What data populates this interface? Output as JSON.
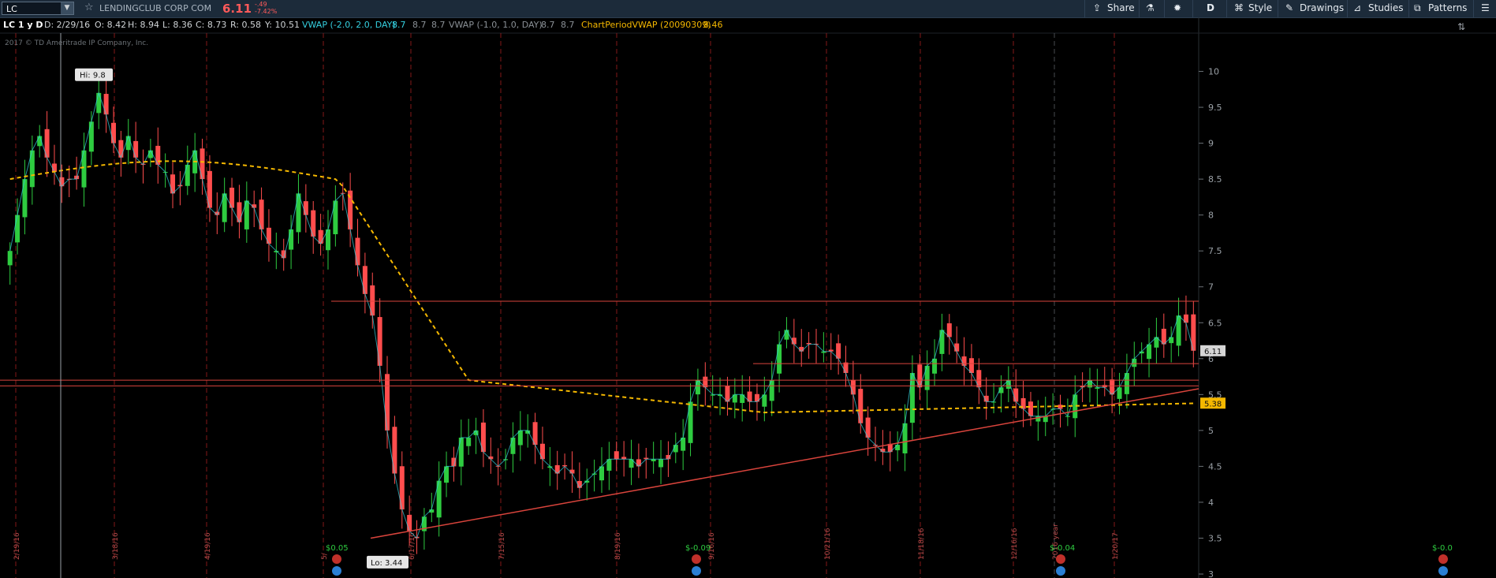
{
  "toolbar": {
    "symbol": "LC",
    "company": "LENDINGCLUB CORP COM",
    "price": "6.11",
    "change": "-.49",
    "change_pct": "-7.42%",
    "share": "Share",
    "timeframe": "D",
    "style": "Style",
    "drawings": "Drawings",
    "studies": "Studies",
    "patterns": "Patterns"
  },
  "infobar": {
    "title": "LC 1 y D",
    "date": "D: 2/29/16",
    "open": "O: 8.42",
    "high": "H: 8.94",
    "low": "L: 8.36",
    "close": "C: 8.73",
    "range": "R: 0.58",
    "y": "Y: 10.51",
    "vwap1_label": "VWAP (-2.0, 2.0, DAY)",
    "vwap1_v1": "8.7",
    "vwap1_v2": "8.7",
    "vwap1_v3": "8.7",
    "vwap2_label": "VWAP (-1.0, 1.0, DAY)",
    "vwap2_v1": "8.7",
    "vwap2_v2": "8.7",
    "cpvwap_label": "ChartPeriodVWAP (20090309)",
    "cpvwap_value": "8.46"
  },
  "copyright": "2017 © TD Ameritrade IP Company, Inc.",
  "chart_data": {
    "type": "candlestick",
    "symbol": "LC",
    "period": "1 y D",
    "ylim": [
      3,
      10.5
    ],
    "y_ticks": [
      3,
      3.5,
      4,
      4.5,
      5,
      5.5,
      6,
      6.5,
      7,
      7.5,
      8,
      8.5,
      9,
      9.5,
      10
    ],
    "x_labels": [
      "2/19/16",
      "3/18/16",
      "4/19/16",
      "5/",
      "6/17/16",
      "7/15/16",
      "8/19/16",
      "9/16/16",
      "10/21/16",
      "11/18/16",
      "12/16/16",
      "2016 year",
      "1/20/17"
    ],
    "hi_label": "Hi: 9.8",
    "hi_value": 9.8,
    "lo_label": "Lo: 3.44",
    "lo_value": 3.44,
    "last_price": "6.11",
    "vwap_last": "5.38",
    "horizontal_lines": [
      6.8,
      5.93,
      5.7,
      5.62
    ],
    "trendline": {
      "start": 3.5,
      "end": 5.58
    },
    "events": [
      {
        "label": "$0.05",
        "x_label": "5/"
      },
      {
        "label": "$-0.09",
        "x_label": "8/19/16"
      },
      {
        "label": "$-0.04",
        "x_label": "11/18/16"
      },
      {
        "label": "$-0.0",
        "x_label": "1/20/17"
      }
    ],
    "closes": [
      7.5,
      8.0,
      8.5,
      8.9,
      9.1,
      8.8,
      8.6,
      8.4,
      8.5,
      8.5,
      8.9,
      9.3,
      9.7,
      9.4,
      9.0,
      8.8,
      9.1,
      8.8,
      8.7,
      8.9,
      8.7,
      8.6,
      8.3,
      8.4,
      8.7,
      8.9,
      8.5,
      8.1,
      8.0,
      8.3,
      8.1,
      7.9,
      8.2,
      8.1,
      7.8,
      7.6,
      7.5,
      7.4,
      7.8,
      8.3,
      8.0,
      7.7,
      7.6,
      7.8,
      8.2,
      8.3,
      7.8,
      7.3,
      6.9,
      6.6,
      5.9,
      5.0,
      4.4,
      3.9,
      3.6,
      3.5,
      3.8,
      3.9,
      4.3,
      4.5,
      4.5,
      4.9,
      4.9,
      5.0,
      4.7,
      4.6,
      4.5,
      4.6,
      4.9,
      5.0,
      5.0,
      4.8,
      4.6,
      4.5,
      4.4,
      4.5,
      4.4,
      4.2,
      4.3,
      4.4,
      4.5,
      4.6,
      4.6,
      4.6,
      4.6,
      4.5,
      4.6,
      4.6,
      4.6,
      4.6,
      4.8,
      4.9,
      5.4,
      5.7,
      5.6,
      5.5,
      5.5,
      5.4,
      5.5,
      5.5,
      5.4,
      5.4,
      5.5,
      5.7,
      6.2,
      6.4,
      6.2,
      6.1,
      6.2,
      6.2,
      6.1,
      6.1,
      6.0,
      5.8,
      5.5,
      5.1,
      4.9,
      4.8,
      4.7,
      4.7,
      4.8,
      5.1,
      5.8,
      5.6,
      5.9,
      6.0,
      6.4,
      6.3,
      6.1,
      5.9,
      5.8,
      5.6,
      5.4,
      5.4,
      5.6,
      5.7,
      5.4,
      5.3,
      5.2,
      5.2,
      5.2,
      5.3,
      5.3,
      5.2,
      5.5,
      5.6,
      5.7,
      5.6,
      5.6,
      5.5,
      5.6,
      5.8,
      6.0,
      6.1,
      6.2,
      6.3,
      6.2,
      6.3,
      6.6,
      6.5,
      6.11
    ]
  },
  "colors": {
    "up": "#2ecc40",
    "down": "#ff4d4d",
    "vwap": "#f5b800",
    "line": "#d9443c",
    "grid": "#b02020"
  }
}
